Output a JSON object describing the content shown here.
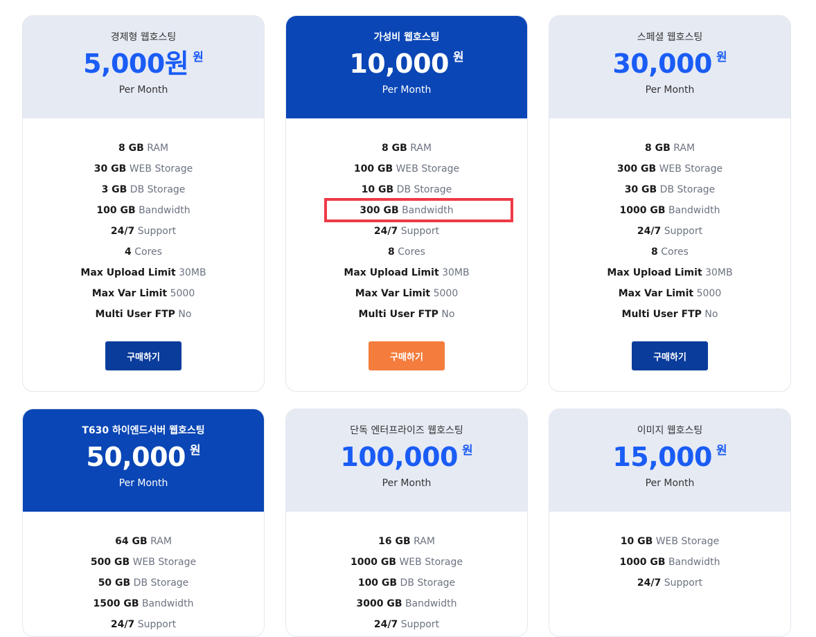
{
  "plans": [
    {
      "name": "경제형 웹호스팅",
      "price": "5,000원",
      "currency": "원",
      "period": "Per Month",
      "features": [
        {
          "value": "8 GB",
          "label": "RAM"
        },
        {
          "value": "30 GB",
          "label": "WEB Storage"
        },
        {
          "value": "3 GB",
          "label": "DB Storage"
        },
        {
          "value": "100 GB",
          "label": "Bandwidth"
        },
        {
          "value": "24/7",
          "label": "Support"
        },
        {
          "value": "4",
          "label": "Cores"
        },
        {
          "value": "Max Upload Limit",
          "label": "30MB"
        },
        {
          "value": "Max Var Limit",
          "label": "5000"
        },
        {
          "value": "Multi User FTP",
          "label": "No"
        }
      ],
      "button_label": "구매하기"
    },
    {
      "name": "가성비 웹호스팅",
      "price": "10,000",
      "currency": "원",
      "period": "Per Month",
      "features": [
        {
          "value": "8 GB",
          "label": "RAM"
        },
        {
          "value": "100 GB",
          "label": "WEB Storage"
        },
        {
          "value": "10 GB",
          "label": "DB Storage"
        },
        {
          "value": "300 GB",
          "label": "Bandwidth"
        },
        {
          "value": "24/7",
          "label": "Support"
        },
        {
          "value": "8",
          "label": "Cores"
        },
        {
          "value": "Max Upload Limit",
          "label": "30MB"
        },
        {
          "value": "Max Var Limit",
          "label": "5000"
        },
        {
          "value": "Multi User FTP",
          "label": "No"
        }
      ],
      "button_label": "구매하기"
    },
    {
      "name": "스페셜 웹호스팅",
      "price": "30,000",
      "currency": "원",
      "period": "Per Month",
      "features": [
        {
          "value": "8 GB",
          "label": "RAM"
        },
        {
          "value": "300 GB",
          "label": "WEB Storage"
        },
        {
          "value": "30 GB",
          "label": "DB Storage"
        },
        {
          "value": "1000 GB",
          "label": "Bandwidth"
        },
        {
          "value": "24/7",
          "label": "Support"
        },
        {
          "value": "8",
          "label": "Cores"
        },
        {
          "value": "Max Upload Limit",
          "label": "30MB"
        },
        {
          "value": "Max Var Limit",
          "label": "5000"
        },
        {
          "value": "Multi User FTP",
          "label": "No"
        }
      ],
      "button_label": "구매하기"
    },
    {
      "name": "T630 하이엔드서버 웹호스팅",
      "price": "50,000",
      "currency": "원",
      "period": "Per Month",
      "features": [
        {
          "value": "64 GB",
          "label": "RAM"
        },
        {
          "value": "500 GB",
          "label": "WEB Storage"
        },
        {
          "value": "50 GB",
          "label": "DB Storage"
        },
        {
          "value": "1500 GB",
          "label": "Bandwidth"
        },
        {
          "value": "24/7",
          "label": "Support"
        }
      ]
    },
    {
      "name": "단독 엔터프라이즈 웹호스팅",
      "price": "100,000",
      "currency": "원",
      "period": "Per Month",
      "features": [
        {
          "value": "16 GB",
          "label": "RAM"
        },
        {
          "value": "1000 GB",
          "label": "WEB Storage"
        },
        {
          "value": "100 GB",
          "label": "DB Storage"
        },
        {
          "value": "3000 GB",
          "label": "Bandwidth"
        },
        {
          "value": "24/7",
          "label": "Support"
        }
      ]
    },
    {
      "name": "이미지 웹호스팅",
      "price": "15,000",
      "currency": "원",
      "period": "Per Month",
      "features": [
        {
          "value": "10 GB",
          "label": "WEB Storage"
        },
        {
          "value": "1000 GB",
          "label": "Bandwidth"
        },
        {
          "value": "24/7",
          "label": "Support"
        }
      ]
    }
  ],
  "colors": {
    "accent_blue": "#1a5cf5",
    "featured_header": "#0a46b5",
    "header_light": "#e6eaf3",
    "buy_button": "#0a3c9b",
    "buy_button_accent": "#f47c3c",
    "highlight_box": "#ee3a46"
  }
}
